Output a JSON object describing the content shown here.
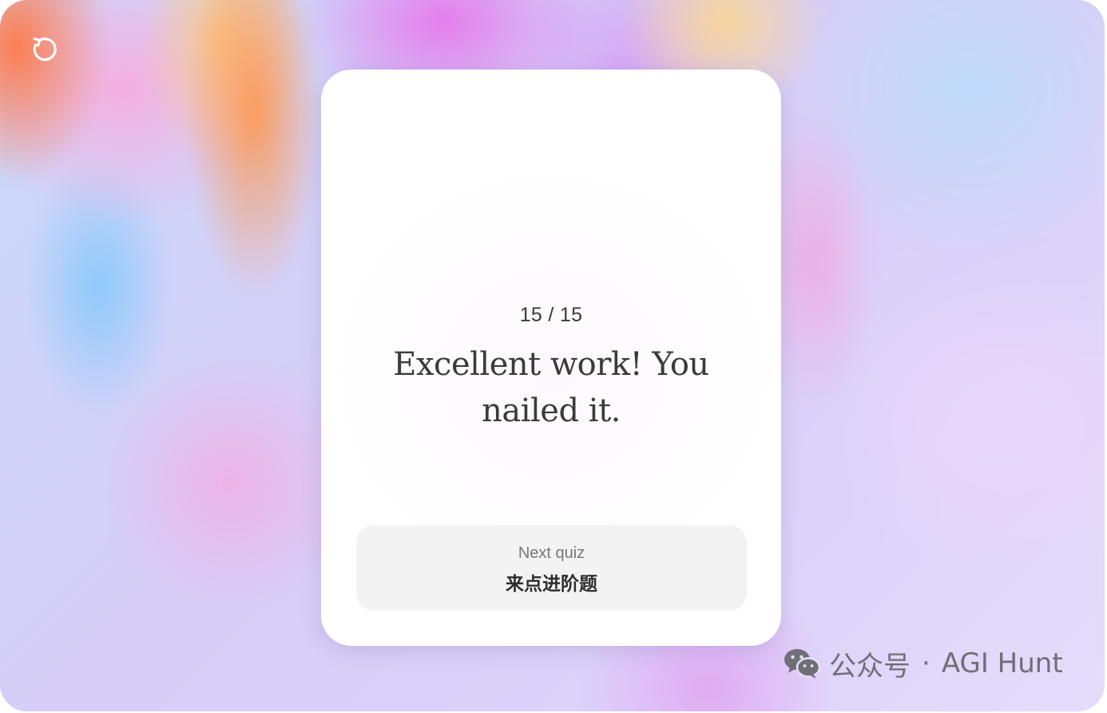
{
  "controls": {
    "restart_icon": "restart-icon"
  },
  "card": {
    "progress": "15 / 15",
    "message": "Excellent work! You nailed it.",
    "next_quiz": {
      "label": "Next quiz",
      "title": "来点进阶题"
    }
  },
  "watermark": {
    "icon": "wechat-icon",
    "account_label": "公众号",
    "separator": "·",
    "name": "AGI Hunt"
  },
  "colors": {
    "card_background": "#ffffff",
    "next_quiz_background": "#f4f3f4",
    "text_primary": "#3b3b3b",
    "text_secondary": "#777777",
    "icon_color": "#ffffff"
  }
}
